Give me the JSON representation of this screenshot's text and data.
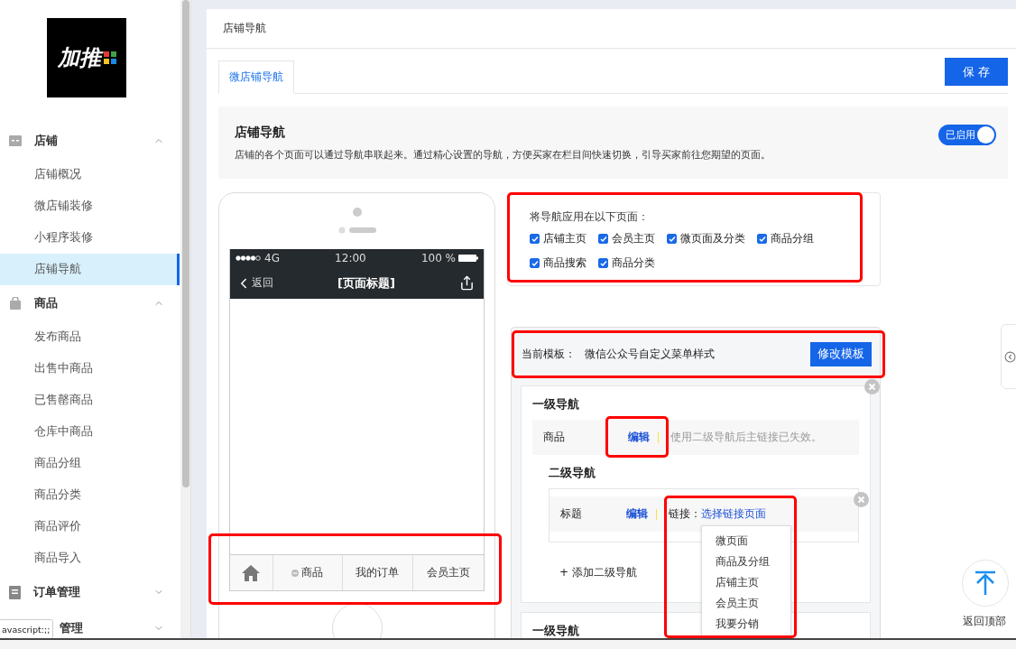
{
  "sidebar": {
    "logo": {
      "text": "加推"
    },
    "groups": [
      {
        "label": "店铺",
        "kind": "store",
        "expanded": true,
        "items": [
          {
            "label": "店铺概况",
            "selected": false
          },
          {
            "label": "微店铺装修",
            "selected": false
          },
          {
            "label": "小程序装修",
            "selected": false
          },
          {
            "label": "店铺导航",
            "selected": true
          }
        ]
      },
      {
        "label": "商品",
        "kind": "bag",
        "expanded": true,
        "items": [
          {
            "label": "发布商品",
            "selected": false
          },
          {
            "label": "出售中商品",
            "selected": false
          },
          {
            "label": "已售罄商品",
            "selected": false
          },
          {
            "label": "仓库中商品",
            "selected": false
          },
          {
            "label": "商品分组",
            "selected": false
          },
          {
            "label": "商品分类",
            "selected": false
          },
          {
            "label": "商品评价",
            "selected": false
          },
          {
            "label": "商品导入",
            "selected": false
          }
        ]
      },
      {
        "label": "订单管理",
        "kind": "doc",
        "expanded": false
      },
      {
        "label": "管理",
        "kind": "covered",
        "expanded": false
      }
    ]
  },
  "breadcrumb": "店铺导航",
  "tabs": [
    {
      "label": "微店铺导航",
      "selected": true
    }
  ],
  "save_button": "保 存",
  "intro": {
    "title": "店铺导航",
    "description": "店铺的各个页面可以通过导航串联起来。通过精心设置的导航，方便买家在栏目间快速切换，引导买家前往您期望的页面。",
    "toggle": {
      "label": "已启用",
      "on": true
    }
  },
  "phone": {
    "network": "4G",
    "time": "12:00",
    "battery": "100 %",
    "back": "返回",
    "title": "[页面标题]",
    "tabbar": [
      {
        "kind": "home"
      },
      {
        "kind": "menu",
        "label": "商品"
      },
      {
        "kind": "link",
        "label": "我的订单"
      },
      {
        "kind": "link",
        "label": "会员主页"
      }
    ]
  },
  "apply_pages": {
    "title": "将导航应用在以下页面：",
    "options": [
      {
        "label": "店铺主页",
        "checked": true
      },
      {
        "label": "会员主页",
        "checked": true
      },
      {
        "label": "微页面及分类",
        "checked": true
      },
      {
        "label": "商品分组",
        "checked": true
      },
      {
        "label": "商品搜索",
        "checked": true
      },
      {
        "label": "商品分类",
        "checked": true
      }
    ]
  },
  "template": {
    "label": "当前模板：",
    "value": "微信公众号自定义菜单样式",
    "button": "修改模板"
  },
  "nav_items": [
    {
      "heading": "一级导航",
      "title": "商品",
      "edit": "编辑",
      "hint": "使用二级导航后主链接已失效。",
      "sub_heading": "二级导航",
      "sub_items": [
        {
          "title": "标题",
          "edit": "编辑",
          "link_label": "链接：",
          "link": "选择链接页面"
        }
      ],
      "add_sub": "+ 添加二级导航"
    },
    {
      "heading": "一级导航"
    }
  ],
  "link_menu": [
    "微页面",
    "商品及分组",
    "店铺主页",
    "会员主页",
    "我要分销"
  ],
  "back_to_top": "返回顶部",
  "status_tooltip": "avascript:;;"
}
